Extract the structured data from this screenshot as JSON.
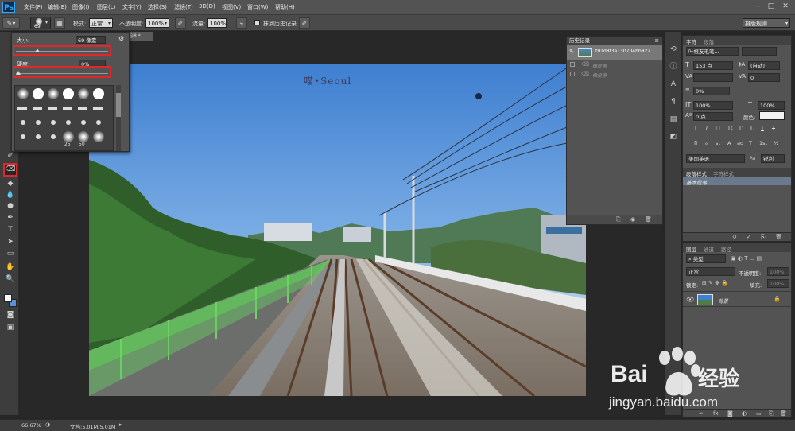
{
  "menubar": {
    "logo": "Ps",
    "items": [
      "文件(F)",
      "编辑(E)",
      "图像(I)",
      "图层(L)",
      "文字(Y)",
      "选择(S)",
      "滤镜(T)",
      "3D(D)",
      "视图(V)",
      "窗口(W)",
      "帮助(H)"
    ],
    "window_controls": [
      "–",
      "□",
      "✕"
    ]
  },
  "options": {
    "brush_size": "69",
    "mode_label": "模式:",
    "mode_value": "正常",
    "opacity_label": "不透明度:",
    "opacity_value": "100%",
    "flow_label": "流量:",
    "flow_value": "100%",
    "erase_history_label": "抹到历史记录",
    "workspace": "排版规则"
  },
  "brush_popup": {
    "size_label": "大小:",
    "size_value": "69 像素",
    "hardness_label": "硬度:",
    "hardness_value": "0%",
    "size_level": 0.23,
    "hardness_level": 0.0,
    "preset_numbers": [
      "25",
      "50"
    ]
  },
  "document": {
    "tab_title": "@8 *",
    "photo_caption": "喵•Seoul"
  },
  "history": {
    "title": "历史记录",
    "snapshot_name": "t01d8f3a130704bb822...",
    "steps": [
      "橡皮擦",
      "橡皮擦"
    ]
  },
  "character": {
    "tabs": [
      "字符",
      "段落"
    ],
    "font_family": "叶根友毛笔...",
    "font_style": "-",
    "font_size": "153 点",
    "leading": "(自动)",
    "kerning": "",
    "tracking": "0",
    "scale_pct": "0%",
    "vertical_scale": "100%",
    "horizontal_scale": "100%",
    "baseline_shift": "0 点",
    "color_label": "颜色:",
    "language": "美国英语",
    "antialias": "锐利",
    "style_buttons": [
      "T",
      "T",
      "TT",
      "Tt",
      "T'",
      "T,",
      "T",
      "T"
    ],
    "opentype_buttons": [
      "fi",
      "ℴ",
      "st",
      "A",
      "ad",
      "T",
      "1st",
      "½"
    ]
  },
  "para_styles": {
    "tabs": [
      "段落样式",
      "字符样式"
    ],
    "item": "基本段落"
  },
  "layers": {
    "tabs": [
      "图层",
      "通道",
      "路径"
    ],
    "filter_label": "类型",
    "blend_mode": "正常",
    "opacity_label": "不透明度:",
    "opacity_value": "100%",
    "lock_label": "锁定:",
    "fill_label": "填充:",
    "fill_value": "100%",
    "layer_name": "背景"
  },
  "status": {
    "zoom": "66.67%",
    "doc_info": "文档:5.01M/5.01M"
  },
  "watermark": {
    "brand_left": "Bai",
    "brand_right": "经验",
    "url": "jingyan.baidu.com"
  }
}
